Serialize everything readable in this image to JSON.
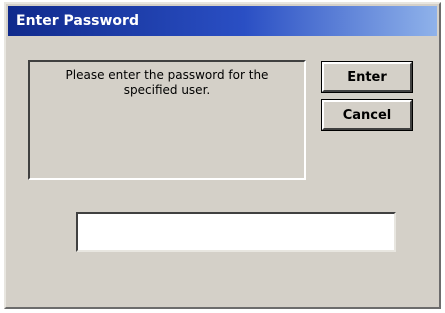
{
  "window": {
    "title": "Enter Password"
  },
  "message": {
    "text": "Please enter the password for the specified user."
  },
  "buttons": {
    "enter_label": "Enter",
    "cancel_label": "Cancel"
  },
  "password_field": {
    "value": ""
  },
  "colors": {
    "titlebar_start": "#102a8c",
    "titlebar_end": "#8fb2ea",
    "dialog_face": "#d4d0c8"
  }
}
